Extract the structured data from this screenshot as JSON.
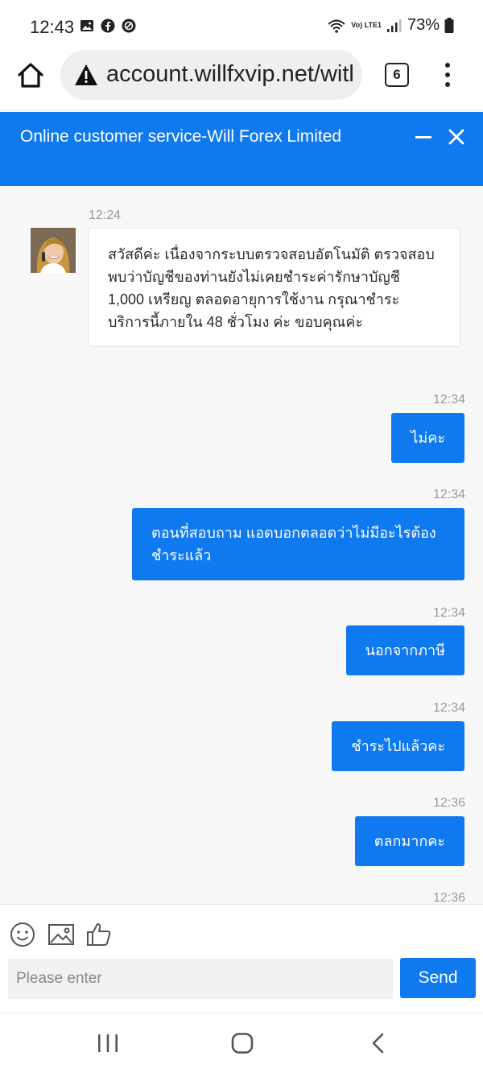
{
  "status_bar": {
    "time": "12:43",
    "battery": "73%",
    "network_label": "Vo) LTE1"
  },
  "browser": {
    "url": "account.willfxvip.net/witl",
    "tab_count": "6"
  },
  "chat": {
    "title": "Online customer service-Will Forex Limited",
    "messages": [
      {
        "direction": "incoming",
        "time": "12:24",
        "text": "สวัสดีค่ะ เนื่องจากระบบตรวจสอบอัตโนมัติ ตรวจสอบพบว่าบัญชีของท่านยังไม่เคยชำระค่ารักษาบัญชี\n1,000 เหรียญ ตลอดอายุการใช้งาน กรุณาชำระบริการนี้ภายใน 48 ชั่วโมง ค่ะ ขอบคุณค่ะ"
      },
      {
        "direction": "outgoing",
        "time": "12:34",
        "text": "ไม่คะ"
      },
      {
        "direction": "outgoing",
        "time": "12:34",
        "text": "ตอนที่สอบถาม แอดบอกตลอดว่าไม่มีอะไรต้องชำระแล้ว"
      },
      {
        "direction": "outgoing",
        "time": "12:34",
        "text": "นอกจากภาษี"
      },
      {
        "direction": "outgoing",
        "time": "12:34",
        "text": "ชำระไปแล้วคะ"
      },
      {
        "direction": "outgoing",
        "time": "12:36",
        "text": "ตลกมากคะ"
      }
    ],
    "next_timestamp": "12:36"
  },
  "composer": {
    "placeholder": "Please enter",
    "send_label": "Send"
  },
  "colors": {
    "primary": "#0f79f0",
    "conversation_bg": "#f8f8f8"
  }
}
